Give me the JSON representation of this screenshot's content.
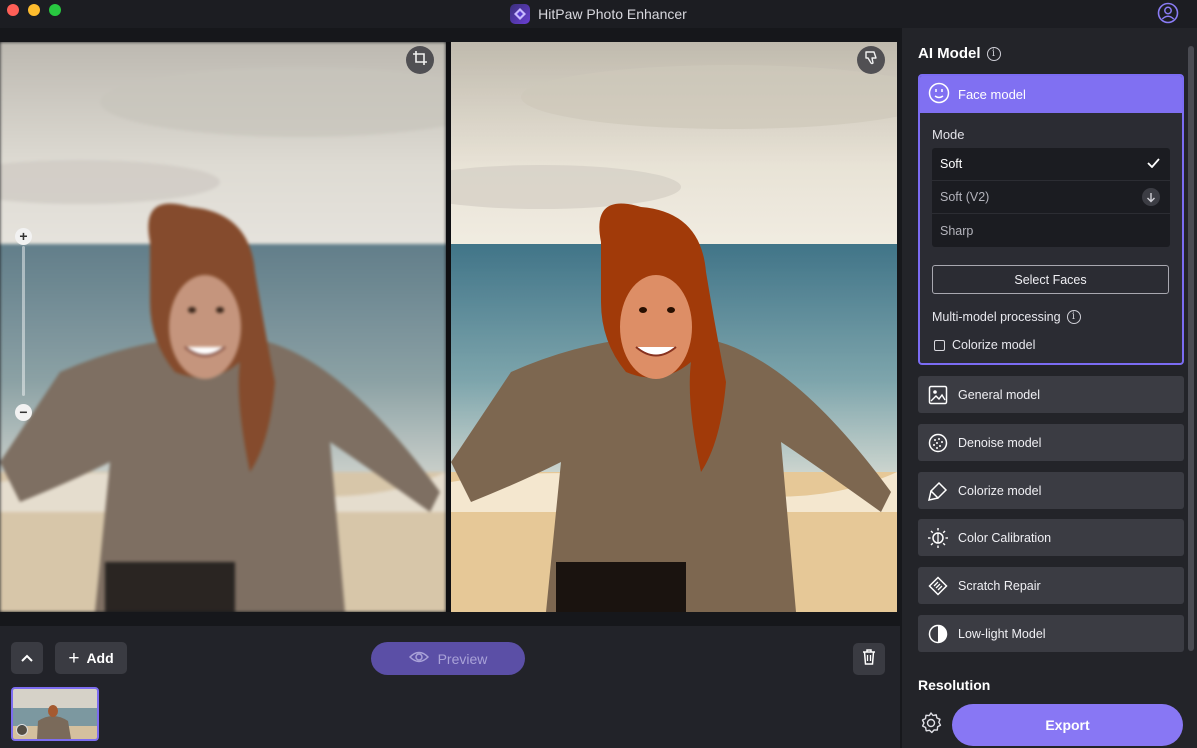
{
  "window": {
    "title": "HitPaw Photo Enhancer"
  },
  "bottombar": {
    "add_label": "Add",
    "preview_label": "Preview"
  },
  "panel": {
    "ai_model_heading": "AI Model",
    "face_model": {
      "label": "Face model",
      "mode_label": "Mode",
      "modes": [
        {
          "label": "Soft",
          "state": "selected"
        },
        {
          "label": "Soft (V2)",
          "state": "download"
        },
        {
          "label": "Sharp",
          "state": "available"
        }
      ],
      "select_faces_label": "Select Faces",
      "multi_model_label": "Multi-model processing",
      "colorize_checkbox_label": "Colorize model",
      "colorize_checked": false
    },
    "models": [
      {
        "label": "General model",
        "icon": "image-icon"
      },
      {
        "label": "Denoise model",
        "icon": "denoise-icon"
      },
      {
        "label": "Colorize model",
        "icon": "brush-icon"
      },
      {
        "label": "Color Calibration",
        "icon": "sun-icon"
      },
      {
        "label": "Scratch Repair",
        "icon": "scratch-icon"
      },
      {
        "label": "Low-light Model",
        "icon": "contrast-icon"
      }
    ],
    "resolution_heading": "Resolution",
    "export_label": "Export"
  },
  "colors": {
    "accent": "#8070f2",
    "preview_bg": "#5b4fa6",
    "panel_bg": "#232429"
  }
}
